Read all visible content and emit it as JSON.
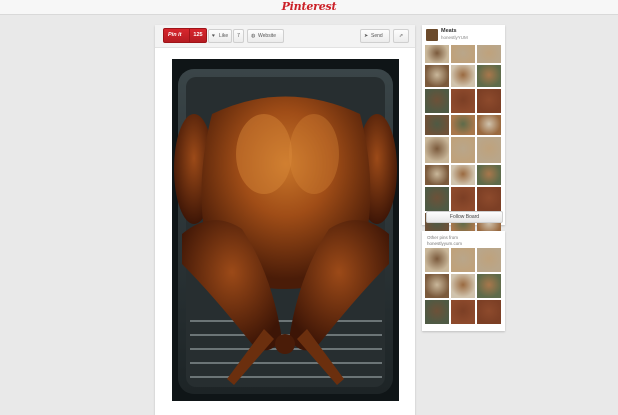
{
  "header": {
    "logo_text": "Pinterest"
  },
  "actions": {
    "pin_it_label": "Pin it",
    "pin_count": "125",
    "like_label": "Like",
    "like_count": "7",
    "website_label": "Website",
    "send_label": "Send"
  },
  "board": {
    "title": "Meats",
    "user": "honestlyYUM",
    "follow_label": "Follow Board"
  },
  "other_pins": {
    "title_line1": "Other pins from",
    "title_line2": "honestlyyum.com"
  },
  "colors": {
    "brand_red": "#cb2027",
    "page_bg": "#e9e9e9"
  },
  "icons": {
    "like": "heart-icon",
    "website": "globe-icon",
    "send": "send-icon",
    "share": "share-icon"
  }
}
